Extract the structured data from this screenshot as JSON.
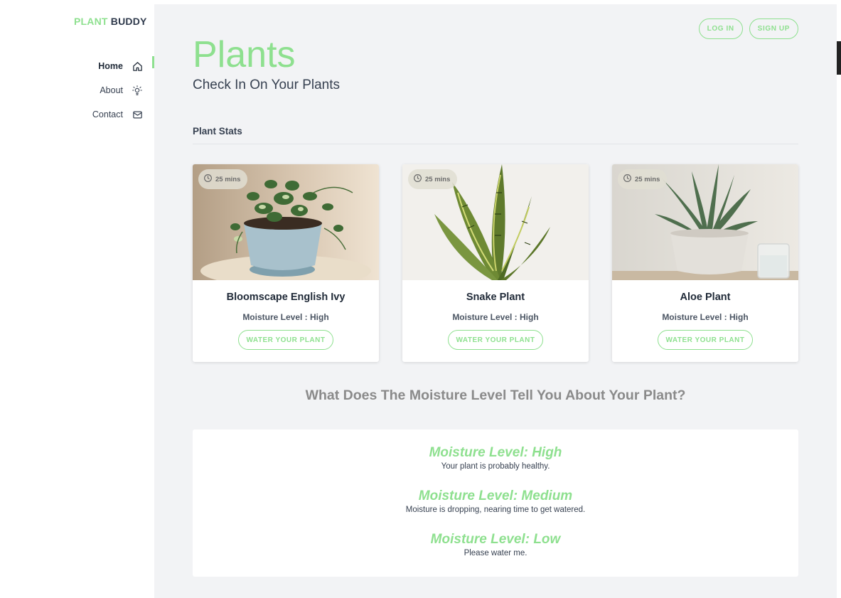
{
  "brand": {
    "accent": "PLANT",
    "rest": "BUDDY"
  },
  "nav": [
    {
      "label": "Home",
      "icon": "home-icon",
      "active": true
    },
    {
      "label": "About",
      "icon": "bulb-icon",
      "active": false
    },
    {
      "label": "Contact",
      "icon": "mail-icon",
      "active": false
    }
  ],
  "auth": {
    "login": "LOG IN",
    "signup": "SIGN UP"
  },
  "page": {
    "title": "Plants",
    "subtitle": "Check In On Your Plants"
  },
  "stats": {
    "title": "Plant Stats",
    "cards": [
      {
        "name": "Bloomscape English Ivy",
        "moisture": "Moisture Level : High",
        "time": "25 mins",
        "button": "WATER YOUR PLANT"
      },
      {
        "name": "Snake Plant",
        "moisture": "Moisture Level : High",
        "time": "25 mins",
        "button": "WATER YOUR PLANT"
      },
      {
        "name": "Aloe Plant",
        "moisture": "Moisture Level : High",
        "time": "25 mins",
        "button": "WATER YOUR PLANT"
      }
    ]
  },
  "info": {
    "question": "What Does The Moisture Level Tell You About Your Plant?",
    "levels": [
      {
        "heading": "Moisture Level: High",
        "desc": "Your plant is probably healthy."
      },
      {
        "heading": "Moisture Level: Medium",
        "desc": "Moisture is dropping, nearing time to get watered."
      },
      {
        "heading": "Moisture Level: Low",
        "desc": "Please water me."
      }
    ]
  },
  "colors": {
    "accent": "#8ee08f",
    "background": "#f2f3f5",
    "text": "#374151",
    "muted": "#8a8a8a"
  }
}
